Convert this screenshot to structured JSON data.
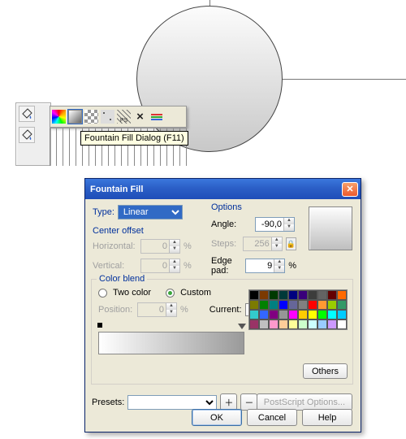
{
  "tooltip": "Fountain Fill Dialog (F11)",
  "toolbar": {
    "icons": [
      "no-fill-icon",
      "uniform-fill-icon",
      "fountain-fill-icon",
      "pattern-fill-icon",
      "texture-fill-icon",
      "postscript-fill-icon",
      "remove-fill-icon",
      "color-docker-icon"
    ]
  },
  "dialog": {
    "title": "Fountain Fill",
    "type_label": "Type:",
    "type_value": "Linear",
    "center_offset_label": "Center offset",
    "horizontal_label": "Horizontal:",
    "horizontal_value": "0",
    "horizontal_suffix": "%",
    "vertical_label": "Vertical:",
    "vertical_value": "0",
    "vertical_suffix": "%",
    "options_label": "Options",
    "angle_label": "Angle:",
    "angle_value": "-90,0",
    "steps_label": "Steps:",
    "steps_value": "256",
    "edgepad_label": "Edge pad:",
    "edgepad_value": "9",
    "percent": "%",
    "colorblend_label": "Color blend",
    "twocolor_label": "Two color",
    "custom_label": "Custom",
    "position_label": "Position:",
    "position_value": "0",
    "current_label": "Current:",
    "others_label": "Others",
    "presets_label": "Presets:",
    "presets_value": "",
    "postscript_label": "PostScript Options...",
    "ok_label": "OK",
    "cancel_label": "Cancel",
    "help_label": "Help",
    "palette": [
      "#000000",
      "#7b3900",
      "#003900",
      "#003939",
      "#000080",
      "#39007b",
      "#3c3c3c",
      "#636363",
      "#630000",
      "#ff6a00",
      "#7b7b00",
      "#008000",
      "#008080",
      "#0000ff",
      "#666699",
      "#808080",
      "#ff0000",
      "#ff9933",
      "#99cc00",
      "#339966",
      "#33cccc",
      "#3366ff",
      "#800080",
      "#969696",
      "#ff00ff",
      "#ffcc00",
      "#ffff00",
      "#00ff00",
      "#00ffff",
      "#00ccff",
      "#993366",
      "#c0c0c0",
      "#ff99cc",
      "#ffcc99",
      "#ffff99",
      "#ccffcc",
      "#ccffff",
      "#99ccff",
      "#cc99ff",
      "#ffffff"
    ]
  }
}
